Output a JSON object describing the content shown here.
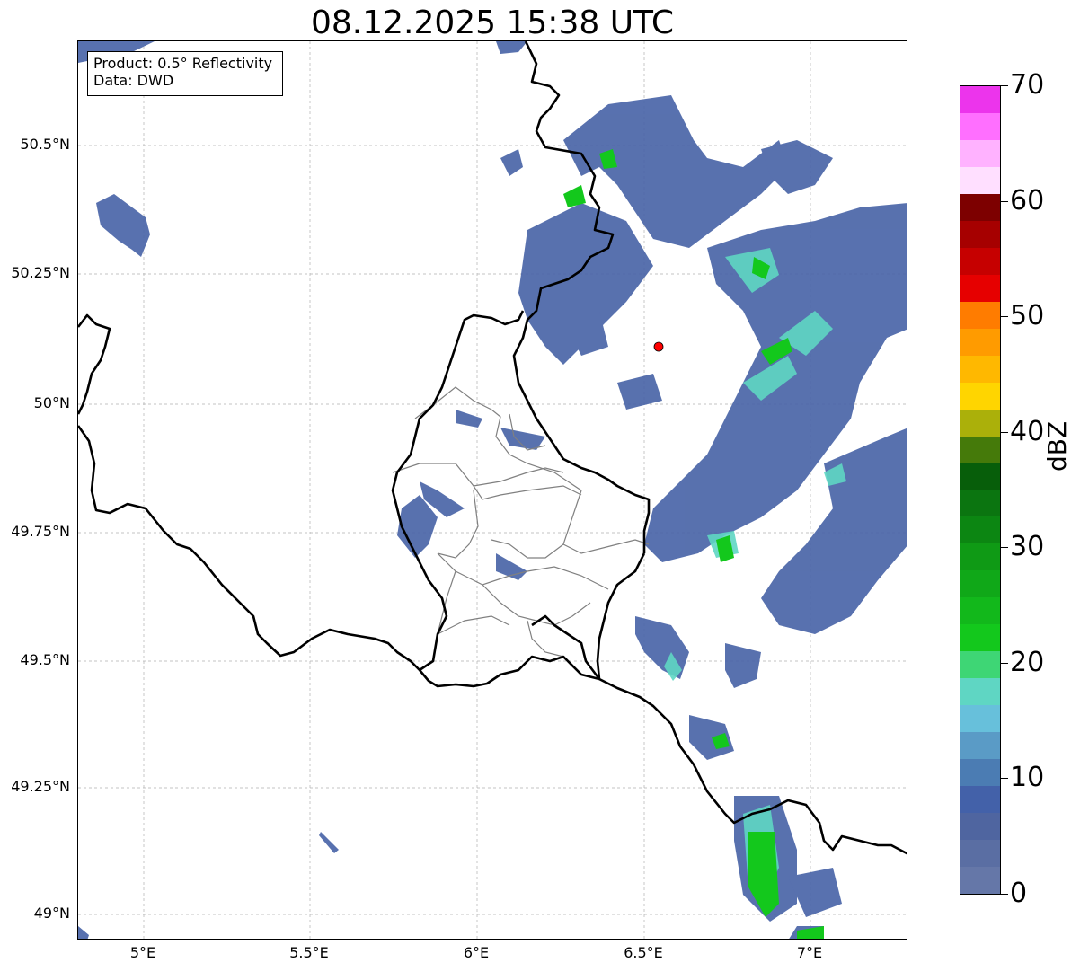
{
  "title": "08.12.2025 15:38 UTC",
  "info": {
    "product": "Product: 0.5° Reflectivity",
    "source": "Data: DWD"
  },
  "axes": {
    "lat_ticks": [
      "50.5°N",
      "50.25°N",
      "50°N",
      "49.75°N",
      "49.5°N",
      "49.25°N",
      "49°N"
    ],
    "lon_ticks": [
      "5°E",
      "5.5°E",
      "6°E",
      "6.5°E",
      "7°E"
    ]
  },
  "colorbar": {
    "label": "dBZ",
    "tick_labels": [
      "0",
      "10",
      "20",
      "30",
      "40",
      "50",
      "60",
      "70"
    ],
    "colors": [
      "#6577a8",
      "#5a6ea3",
      "#4f65a0",
      "#4361a9",
      "#4b7cb3",
      "#5a9bc6",
      "#67c0db",
      "#5fd6c3",
      "#3ed675",
      "#13c81c",
      "#12b81b",
      "#10a818",
      "#0f9a15",
      "#0c8612",
      "#0b7510",
      "#075e0a",
      "#457a0a",
      "#abb00a",
      "#ffd500",
      "#ffb800",
      "#ff9b00",
      "#ff7c00",
      "#e60000",
      "#c60000",
      "#a60000",
      "#7d0000",
      "#ffdfff",
      "#ffb2ff",
      "#ff6fff",
      "#ec34ec"
    ]
  },
  "colors": {
    "radar_weak": "#4a65a8",
    "radar_mid": "#5fd6c3",
    "radar_strong": "#13c81c",
    "border": "#000000",
    "district_border": "#808080",
    "radar_site": "#ff0000"
  }
}
